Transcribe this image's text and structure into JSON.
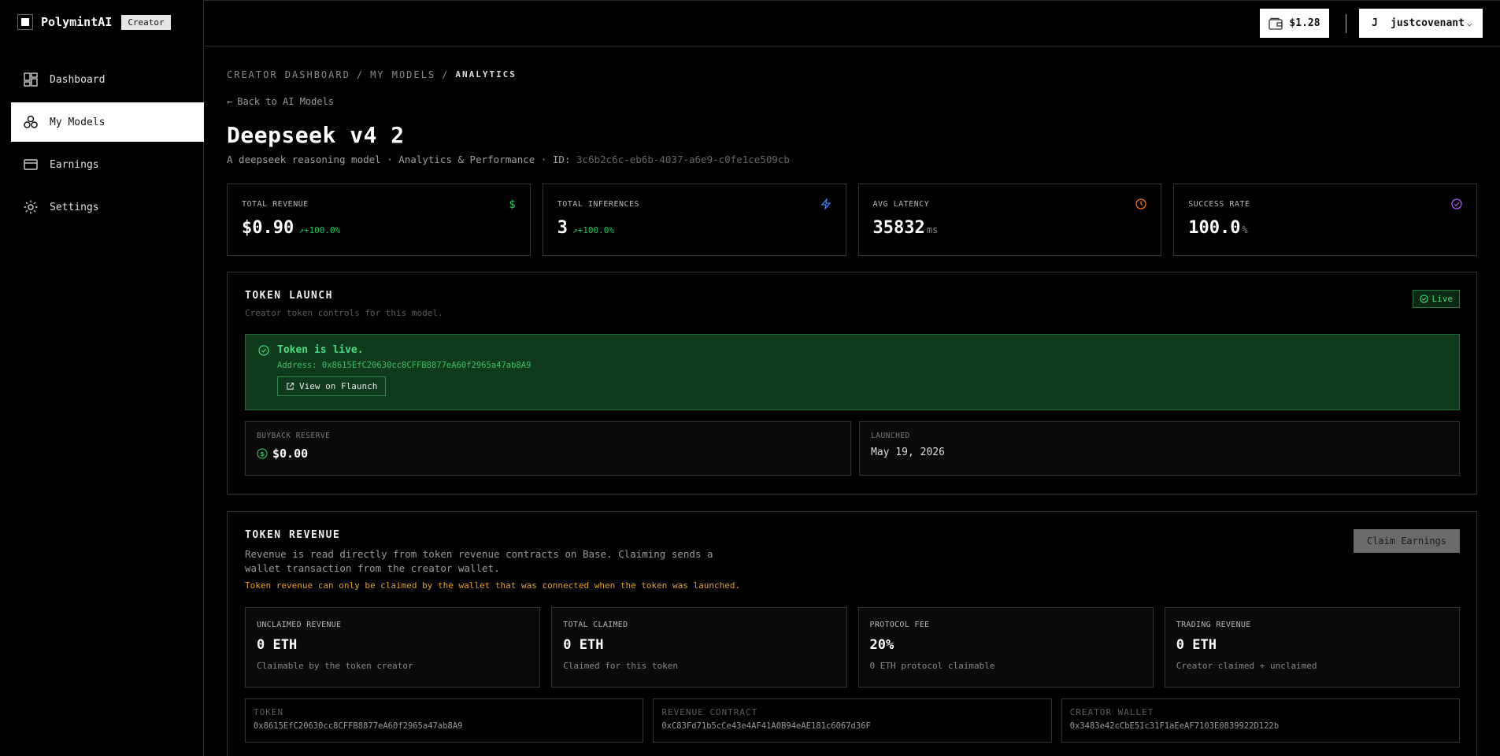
{
  "brand": {
    "name": "PolymintAI",
    "badge": "Creator"
  },
  "sidebar": {
    "items": [
      {
        "label": "Dashboard",
        "icon": "dashboard-icon",
        "active": false
      },
      {
        "label": "My Models",
        "icon": "models-icon",
        "active": true
      },
      {
        "label": "Earnings",
        "icon": "card-icon",
        "active": false
      },
      {
        "label": "Settings",
        "icon": "gear-icon",
        "active": false
      }
    ]
  },
  "topbar": {
    "balance": "$1.28",
    "user_initial": "J",
    "username": "justcovenant"
  },
  "breadcrumb": [
    "CREATOR DASHBOARD",
    "/",
    "MY MODELS",
    "/",
    "ANALYTICS"
  ],
  "back_link": "Back to AI Models",
  "page": {
    "title": "Deepseek v4 2",
    "subtitle_text": "A deepseek reasoning model · Analytics & Performance · ID: ",
    "model_id": "3c6b2c6c-eb6b-4037-a6e9-c0fe1ce509cb"
  },
  "stats": [
    {
      "label": "TOTAL REVENUE",
      "value": "$0.90",
      "change": "+100.0%",
      "unit": "",
      "icon": "dollar-icon",
      "color": "#22c55e"
    },
    {
      "label": "TOTAL INFERENCES",
      "value": "3",
      "change": "+100.0%",
      "unit": "",
      "icon": "bolt-icon",
      "color": "#3b82f6"
    },
    {
      "label": "AVG LATENCY",
      "value": "35832",
      "change": "",
      "unit": "ms",
      "icon": "clock-icon",
      "color": "#f97316"
    },
    {
      "label": "SUCCESS RATE",
      "value": "100.0",
      "change": "",
      "unit": "%",
      "icon": "check-circle-icon",
      "color": "#a855f7"
    }
  ],
  "token_launch": {
    "title": "TOKEN LAUNCH",
    "description": "Creator token controls for this model.",
    "status_badge": "Live",
    "live_heading": "Token is live.",
    "address_text": "Address: 0x8615EfC20630cc8CFFB8877eA60f2965a47ab8A9",
    "view_button": "View on Flaunch",
    "buyback_label": "BUYBACK RESERVE",
    "buyback_value": "$0.00",
    "launched_label": "LAUNCHED",
    "launched_value": "May 19, 2026"
  },
  "token_revenue": {
    "title": "TOKEN REVENUE",
    "description": "Revenue is read directly from token revenue contracts on Base. Claiming sends a wallet transaction from the creator wallet.",
    "warning": "Token revenue can only be claimed by the wallet that was connected when the token was launched.",
    "claim_button": "Claim Earnings",
    "cards": [
      {
        "label": "UNCLAIMED REVENUE",
        "value": "0 ETH",
        "note": "Claimable by the token creator"
      },
      {
        "label": "TOTAL CLAIMED",
        "value": "0 ETH",
        "note": "Claimed for this token"
      },
      {
        "label": "PROTOCOL FEE",
        "value": "20%",
        "note": "0 ETH protocol claimable"
      },
      {
        "label": "TRADING REVENUE",
        "value": "0 ETH",
        "note": "Creator claimed + unclaimed"
      }
    ],
    "addresses": [
      {
        "label": "TOKEN",
        "value": "0x8615EfC20630cc8CFFB8877eA60f2965a47ab8A9"
      },
      {
        "label": "REVENUE CONTRACT",
        "value": "0xC83Fd71b5cCe43e4AF41A0B94eAE181c6067d36F"
      },
      {
        "label": "CREATOR WALLET",
        "value": "0x3483e42cCbE51c31F1aEeAF7103E0839922D122b"
      }
    ]
  }
}
